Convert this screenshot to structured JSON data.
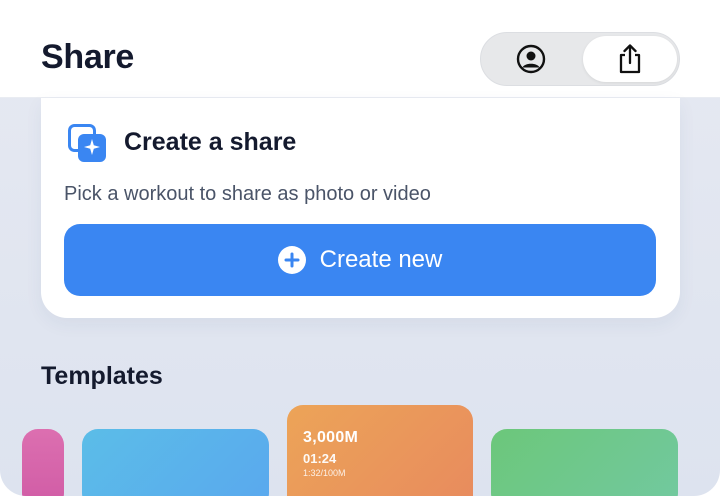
{
  "header": {
    "title": "Share",
    "segments": [
      {
        "icon": "profile-icon",
        "selected": false
      },
      {
        "icon": "share-icon",
        "selected": true
      }
    ]
  },
  "create_card": {
    "icon": "sparkle-stack-icon",
    "title": "Create a share",
    "subtitle": "Pick a workout to share as photo or video",
    "button_label": "Create new",
    "button_icon": "plus-circle-icon"
  },
  "templates": {
    "title": "Templates",
    "items": [
      {
        "color": "#d866ab"
      },
      {
        "color": "#5ab4ec"
      },
      {
        "color": "#ea9659",
        "distance": "3,000M",
        "time": "01:24",
        "pace": "1:32/100M"
      },
      {
        "color": "#6fc88c"
      }
    ]
  },
  "colors": {
    "accent": "#3a86f2",
    "text_primary": "#141a2e",
    "text_secondary": "#4a5468",
    "background": "#e2e6f0"
  }
}
